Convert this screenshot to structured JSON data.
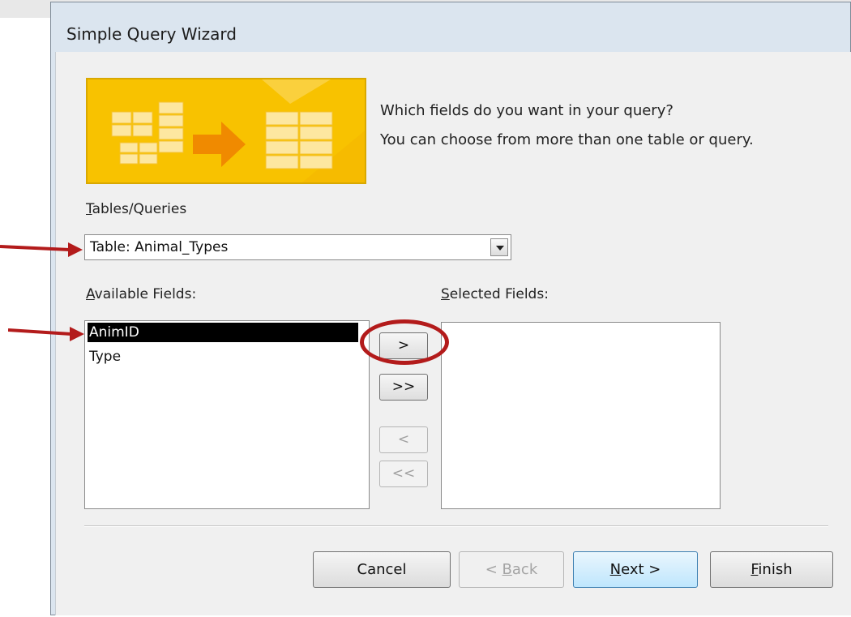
{
  "window": {
    "title": "Simple Query Wizard"
  },
  "prompt": {
    "question": "Which fields do you want in your query?",
    "hint": "You can choose from more than one table or query."
  },
  "tables": {
    "label_first": "T",
    "label_rest": "ables/Queries",
    "selected_value": "Table: Animal_Types"
  },
  "available": {
    "label_first": "A",
    "label_rest": "vailable Fields:",
    "items": [
      "AnimID",
      "Type"
    ],
    "selected_index": 0
  },
  "selected_fields": {
    "label_first": "S",
    "label_rest": "elected Fields:",
    "items": []
  },
  "move_buttons": {
    "add_one": ">",
    "add_all": ">>",
    "remove_one": "<",
    "remove_all": "<<"
  },
  "footer": {
    "cancel": "Cancel",
    "back_prefix": "< ",
    "back_accel": "B",
    "back_rest": "ack",
    "next_accel": "N",
    "next_rest": "ext >",
    "finish_accel": "F",
    "finish_rest": "inish"
  },
  "annotation_colors": {
    "arrow": "#b31b1b",
    "circle": "#b31b1b"
  }
}
